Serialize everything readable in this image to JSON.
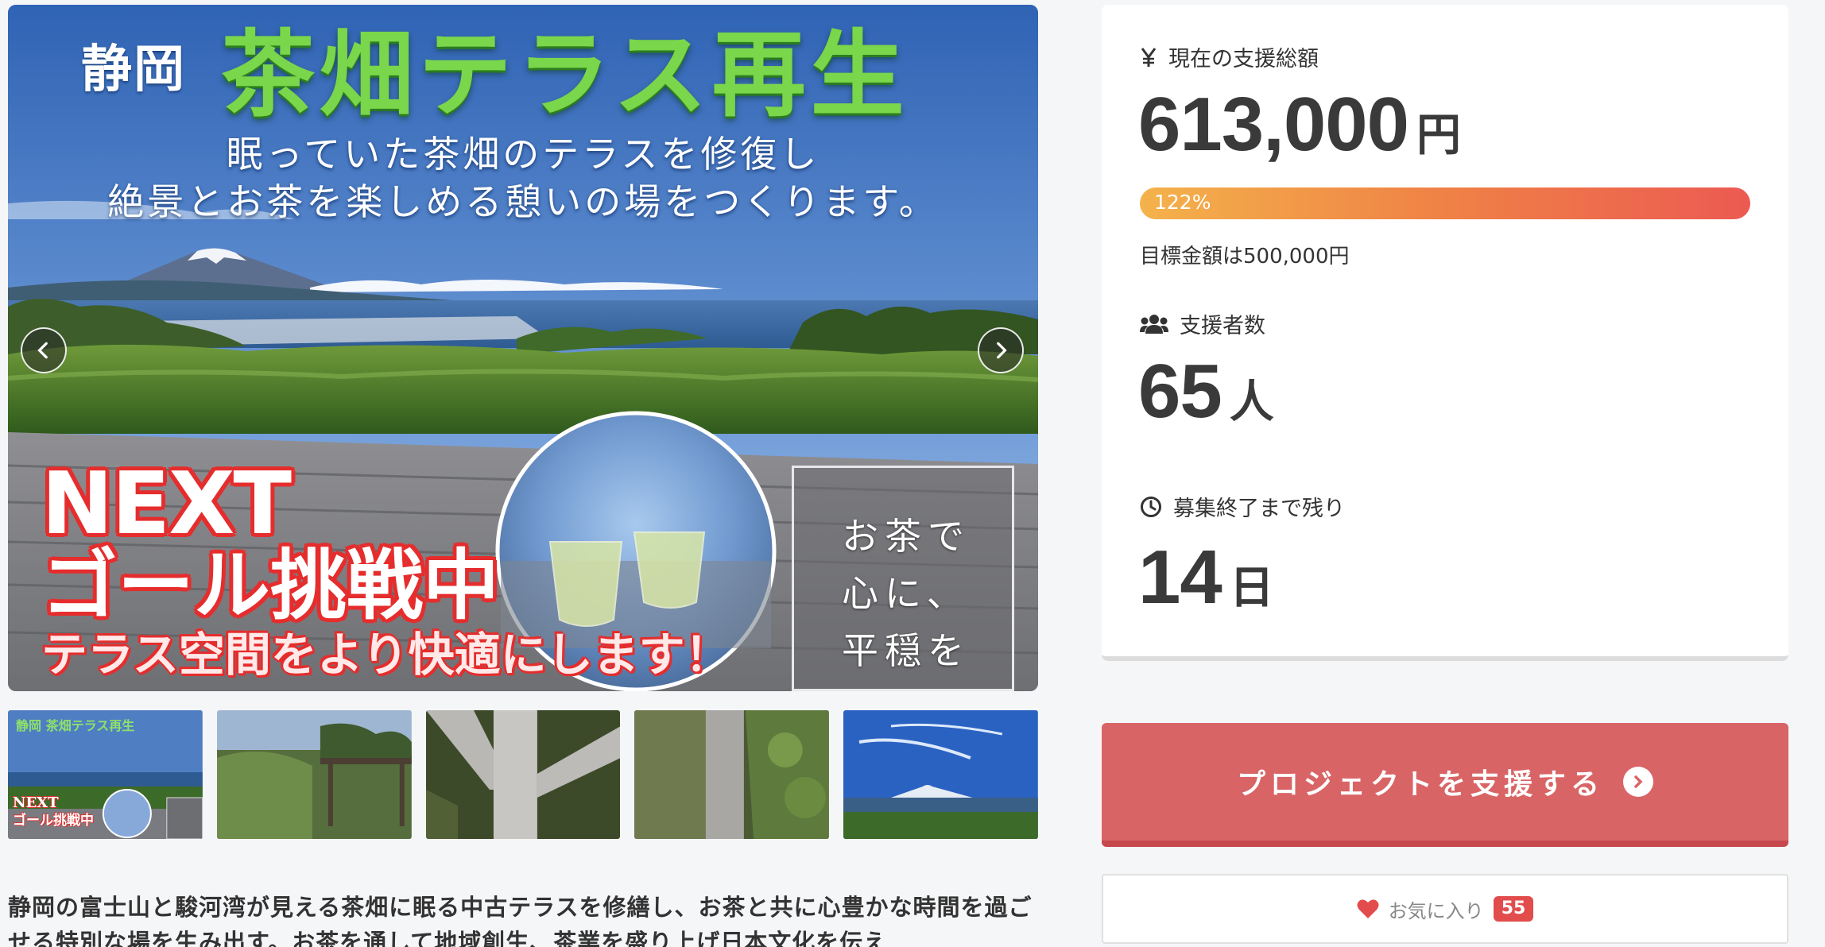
{
  "hero": {
    "prefecture": "静岡",
    "title": "茶畑テラス再生",
    "subtitle_line1": "眠っていた茶畑のテラスを修復し",
    "subtitle_line2": "絶景とお茶を楽しめる憩いの場をつくります。",
    "next_line1": "NEXT",
    "next_line2": "ゴール挑戦中",
    "next_line3": "テラス空間をより快適にします！",
    "poem_line1": "お茶で",
    "poem_line2": "心に、",
    "poem_line3": "平穏を"
  },
  "thumbnails": [
    {
      "title": "静岡 茶畑テラス再生",
      "caption1": "NEXT",
      "caption2": "ゴール挑戦中"
    },
    {},
    {},
    {},
    {}
  ],
  "description": "静岡の富士山と駿河湾が見える茶畑に眠る中古テラスを修繕し、お茶と共に心豊かな時間を過ごせる特別な場を生み出す。お茶を通して地域創生、茶業を盛り上げ日本文化を伝え",
  "stats": {
    "amount_label": "現在の支援総額",
    "amount_value": "613,000",
    "amount_unit": "円",
    "progress_label": "122%",
    "progress_percent": 122,
    "goal_text": "目標金額は500,000円",
    "backers_label": "支援者数",
    "backers_value": "65",
    "backers_unit": "人",
    "remaining_label": "募集終了まで残り",
    "remaining_value": "14",
    "remaining_unit": "日"
  },
  "actions": {
    "support_label": "プロジェクトを支援する",
    "favorite_label": "お気に入り",
    "favorite_count": "55"
  },
  "colors": {
    "support_button": "#d96466",
    "progress_start": "#f4b24b",
    "progress_end": "#ec5a52",
    "badge": "#e24c4c"
  }
}
